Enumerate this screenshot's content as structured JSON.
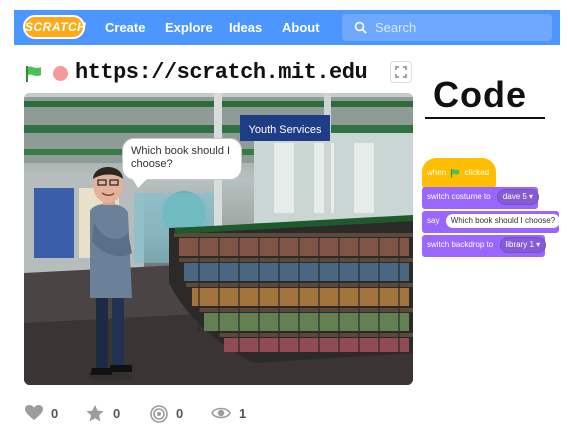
{
  "header": {
    "logo_text": "SCRATCH",
    "nav": [
      "Create",
      "Explore",
      "Ideas",
      "About"
    ],
    "search_placeholder": "Search"
  },
  "project": {
    "url": "https://scratch.mit.edu",
    "speech_bubble": "Which book should I choose?",
    "scene_sign": "Youth Services"
  },
  "code": {
    "title": "Code",
    "blocks": {
      "when_prefix": "when",
      "when_suffix": "clicked",
      "switch_costume": "switch costume to",
      "costume_value": "dave 5 ▾",
      "say": "say",
      "say_value": "Which book should I choose?",
      "switch_backdrop": "switch backdrop to",
      "backdrop_value": "library 1 ▾"
    }
  },
  "stats": {
    "loves": "0",
    "favorites": "0",
    "remixes": "0",
    "views": "1"
  },
  "colors": {
    "nav_blue": "#4c97ff",
    "events_yellow": "#ffbf00",
    "looks_purple": "#9966ff",
    "flag_green": "#4cbf56"
  },
  "icons": [
    "search-icon",
    "green-flag-icon",
    "stop-icon",
    "fullscreen-icon",
    "heart-icon",
    "star-icon",
    "remix-icon",
    "eye-icon"
  ]
}
